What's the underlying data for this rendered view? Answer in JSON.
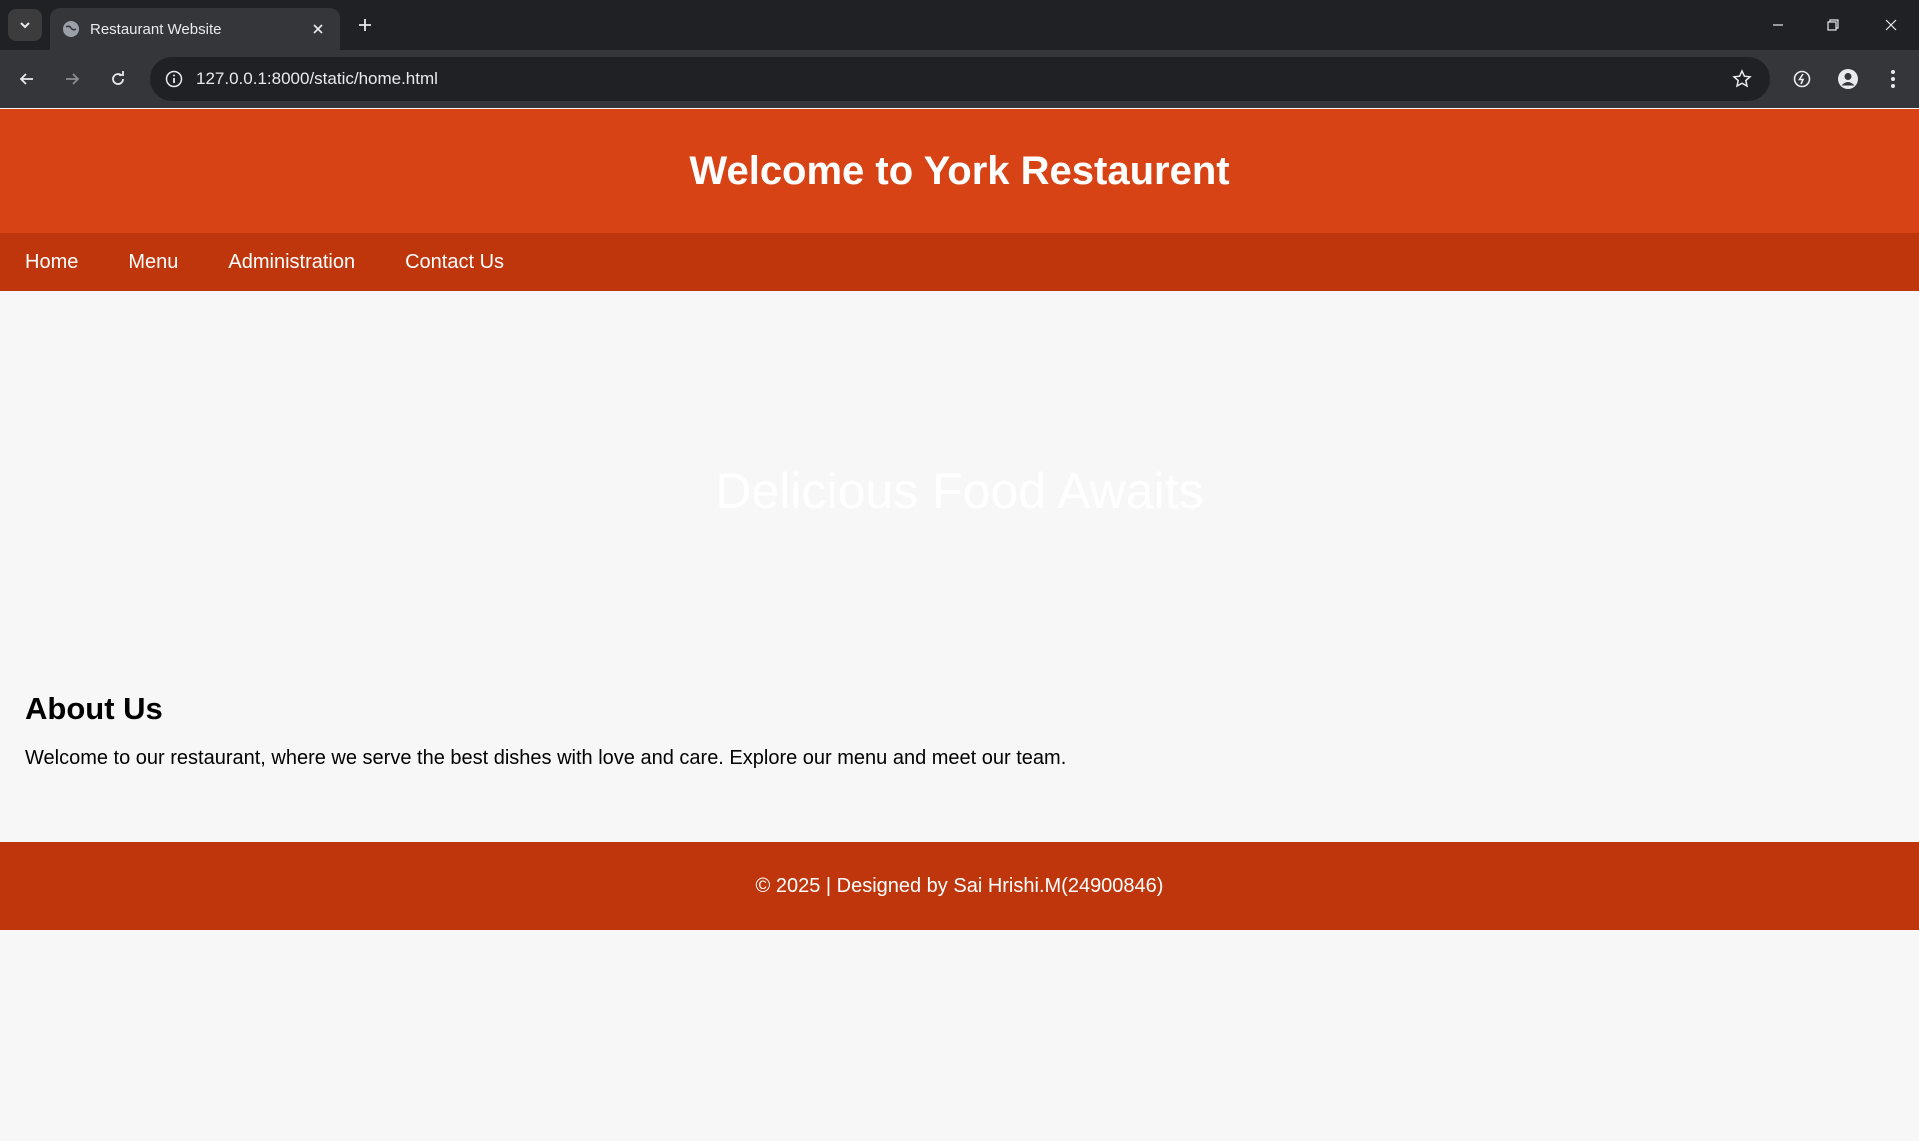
{
  "browser": {
    "tab_title": "Restaurant Website",
    "url": "127.0.0.1:8000/static/home.html"
  },
  "header": {
    "title": "Welcome to York Restaurent"
  },
  "nav": {
    "items": [
      {
        "label": "Home"
      },
      {
        "label": "Menu"
      },
      {
        "label": "Administration"
      },
      {
        "label": "Contact Us"
      }
    ]
  },
  "hero": {
    "text": "Delicious Food Awaits"
  },
  "about": {
    "heading": "About Us",
    "body": "Welcome to our restaurant, where we serve the best dishes with love and care. Explore our menu and meet our team."
  },
  "footer": {
    "text": "© 2025 | Designed by Sai Hrishi.M(24900846)"
  },
  "colors": {
    "header_bg": "#d84315",
    "nav_bg": "#bf360c",
    "footer_bg": "#bf360c",
    "page_bg": "#f7f7f7"
  }
}
